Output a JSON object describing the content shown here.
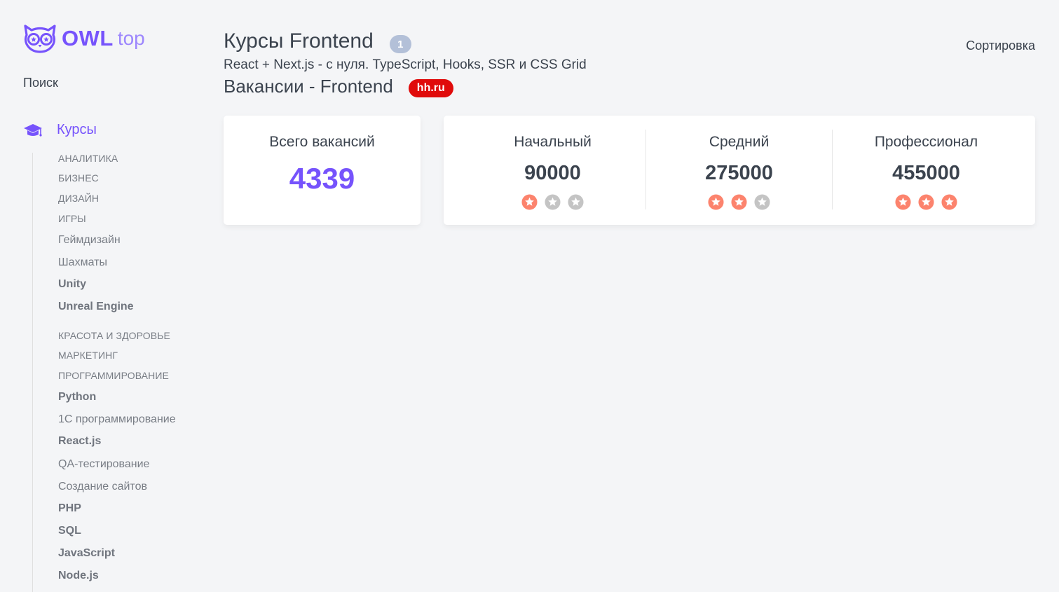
{
  "logo": {
    "main": "OWL",
    "sub": "top"
  },
  "sidebar": {
    "search_label": "Поиск",
    "menu_title": "Курсы",
    "items": [
      {
        "label": "АНАЛИТИКА",
        "kind": "cat"
      },
      {
        "label": "БИЗНЕС",
        "kind": "cat"
      },
      {
        "label": "ДИЗАЙН",
        "kind": "cat"
      },
      {
        "label": "ИГРЫ",
        "kind": "cat"
      },
      {
        "label": "Геймдизайн",
        "kind": "sub"
      },
      {
        "label": "Шахматы",
        "kind": "sub"
      },
      {
        "label": "Unity",
        "kind": "strong"
      },
      {
        "label": "Unreal Engine",
        "kind": "strong"
      },
      {
        "label": "КРАСОТА И ЗДОРОВЬЕ",
        "kind": "cat"
      },
      {
        "label": "МАРКЕТИНГ",
        "kind": "cat"
      },
      {
        "label": "ПРОГРАММИРОВАНИЕ",
        "kind": "cat"
      },
      {
        "label": "Python",
        "kind": "strong"
      },
      {
        "label": "1С программирование",
        "kind": "sub"
      },
      {
        "label": "React.js",
        "kind": "strong"
      },
      {
        "label": "QA-тестирование",
        "kind": "sub"
      },
      {
        "label": "Создание сайтов",
        "kind": "sub"
      },
      {
        "label": "PHP",
        "kind": "strong"
      },
      {
        "label": "SQL",
        "kind": "strong"
      },
      {
        "label": "JavaScript",
        "kind": "strong"
      },
      {
        "label": "Node.js",
        "kind": "strong"
      }
    ]
  },
  "header": {
    "title": "Курсы Frontend",
    "count": "1",
    "sort_label": "Сортировка",
    "course_name": "React + Next.js - с нуля. TypeScript, Hooks, SSR и CSS Grid"
  },
  "vacancies": {
    "title": "Вакансии - Frontend",
    "source_badge": "hh.ru",
    "total_label": "Всего вакансий",
    "total_value": "4339",
    "levels": [
      {
        "label": "Начальный",
        "value": "90000",
        "rating": 1,
        "max": 3
      },
      {
        "label": "Средний",
        "value": "275000",
        "rating": 2,
        "max": 3
      },
      {
        "label": "Профессионал",
        "value": "455000",
        "rating": 3,
        "max": 3
      }
    ]
  },
  "colors": {
    "accent": "#7653fc",
    "star_active": "#fc836d",
    "star_inactive": "#c4c4c4",
    "hh_red": "#e00b0b",
    "badge_gray": "#b3c0d8"
  }
}
